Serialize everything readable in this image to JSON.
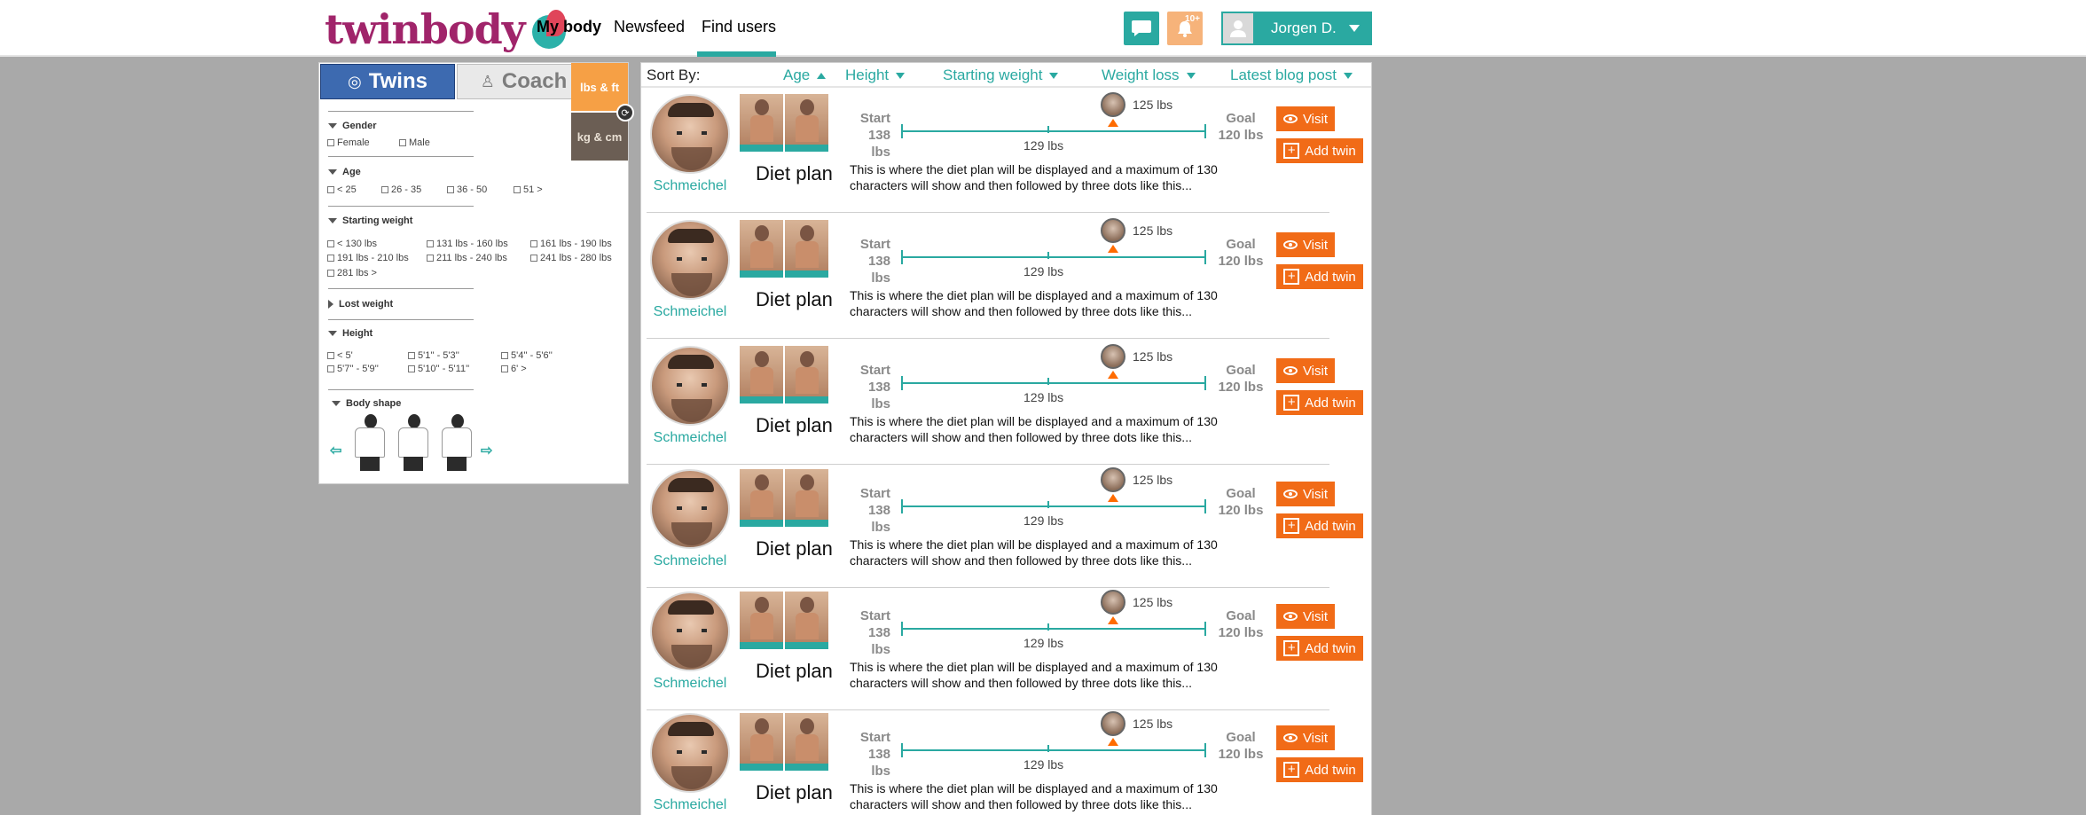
{
  "brand": {
    "logo_text": "twinbody"
  },
  "nav": {
    "items": [
      {
        "label": "My body"
      },
      {
        "label": "Newsfeed"
      },
      {
        "label": "Find users"
      }
    ],
    "notification_count": "10+",
    "user_name": "Jorgen D."
  },
  "filter": {
    "tab_twins": "Twins",
    "tab_coach": "Coach",
    "unit_lbs": "lbs & ft",
    "unit_kg": "kg & cm",
    "gender": {
      "title": "Gender",
      "options": [
        "Female",
        "Male"
      ]
    },
    "age": {
      "title": "Age",
      "options": [
        "< 25",
        "26 - 35",
        "36 - 50",
        "51 >"
      ]
    },
    "starting_weight": {
      "title": "Starting weight",
      "options": [
        "< 130 lbs",
        "131 lbs - 160 lbs",
        "161 lbs - 190 lbs",
        "191 lbs - 210 lbs",
        "211 lbs - 240 lbs",
        "241 lbs - 280 lbs",
        "281 lbs >"
      ]
    },
    "lost_weight": {
      "title": "Lost weight"
    },
    "height": {
      "title": "Height",
      "options": [
        "< 5'",
        "5'1'' - 5'3''",
        "5'4'' - 5'6''",
        "5'7'' - 5'9''",
        "5'10'' - 5'11''",
        "6' >"
      ]
    },
    "body_shape": {
      "title": "Body shape"
    }
  },
  "sort": {
    "label": "Sort By:",
    "options": [
      "Age",
      "Height",
      "Starting weight",
      "Weight loss",
      "Latest blog post"
    ]
  },
  "results": [
    {
      "username": "Schmeichel",
      "start_label": "Start",
      "start_weight": "138 lbs",
      "goal_label": "Goal",
      "goal_weight": "120 lbs",
      "current_weight": "125 lbs",
      "mid_weight": "129 lbs",
      "diet_title": "Diet plan",
      "description": "This is where the diet plan will be displayed and a maximum of 130 characters will show and then followed by three dots like this...",
      "visit_label": "Visit",
      "add_label": "Add twin"
    },
    {
      "username": "Schmeichel",
      "start_label": "Start",
      "start_weight": "138 lbs",
      "goal_label": "Goal",
      "goal_weight": "120 lbs",
      "current_weight": "125 lbs",
      "mid_weight": "129 lbs",
      "diet_title": "Diet plan",
      "description": "This is where the diet plan will be displayed and a maximum of 130 characters will show and then followed by three dots like this...",
      "visit_label": "Visit",
      "add_label": "Add twin"
    },
    {
      "username": "Schmeichel",
      "start_label": "Start",
      "start_weight": "138 lbs",
      "goal_label": "Goal",
      "goal_weight": "120 lbs",
      "current_weight": "125 lbs",
      "mid_weight": "129 lbs",
      "diet_title": "Diet plan",
      "description": "This is where the diet plan will be displayed and a maximum of 130 characters will show and then followed by three dots like this...",
      "visit_label": "Visit",
      "add_label": "Add twin"
    },
    {
      "username": "Schmeichel",
      "start_label": "Start",
      "start_weight": "138 lbs",
      "goal_label": "Goal",
      "goal_weight": "120 lbs",
      "current_weight": "125 lbs",
      "mid_weight": "129 lbs",
      "diet_title": "Diet plan",
      "description": "This is where the diet plan will be displayed and a maximum of 130 characters will show and then followed by three dots like this...",
      "visit_label": "Visit",
      "add_label": "Add twin"
    },
    {
      "username": "Schmeichel",
      "start_label": "Start",
      "start_weight": "138 lbs",
      "goal_label": "Goal",
      "goal_weight": "120 lbs",
      "current_weight": "125 lbs",
      "mid_weight": "129 lbs",
      "diet_title": "Diet plan",
      "description": "This is where the diet plan will be displayed and a maximum of 130 characters will show and then followed by three dots like this...",
      "visit_label": "Visit",
      "add_label": "Add twin"
    },
    {
      "username": "Schmeichel",
      "start_label": "Start",
      "start_weight": "138 lbs",
      "goal_label": "Goal",
      "goal_weight": "120 lbs",
      "current_weight": "125 lbs",
      "mid_weight": "129 lbs",
      "diet_title": "Diet plan",
      "description": "This is where the diet plan will be displayed and a maximum of 130 characters will show and then followed by three dots like this...",
      "visit_label": "Visit",
      "add_label": "Add twin"
    }
  ],
  "colors": {
    "accent": "#2aa9a1",
    "brand": "#a0246a",
    "action": "#f16b17",
    "twins_tab": "#3d6ab0",
    "background": "#a9a9a9"
  },
  "icons": {
    "chat": "chat-bubble-icon",
    "notification": "notification-icon",
    "user": "user-silhouette-icon",
    "visit": "eye-icon",
    "add": "plus-box-icon"
  }
}
